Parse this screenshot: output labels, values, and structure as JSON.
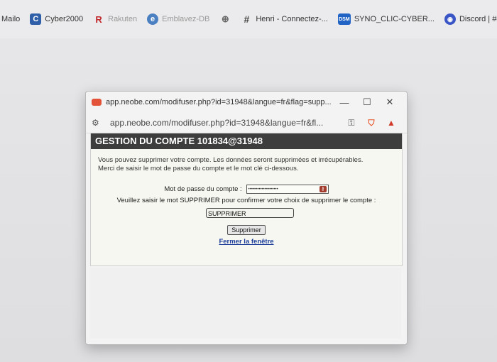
{
  "bookmarks": [
    {
      "label": "Mailo",
      "icon": "none",
      "faded": false
    },
    {
      "label": "Cyber2000",
      "icon": "cyber2000-icon",
      "glyph": "C",
      "faded": false
    },
    {
      "label": "Rakuten",
      "icon": "rakuten-icon",
      "glyph": "R",
      "faded": true
    },
    {
      "label": "Emblavez-DB",
      "icon": "emblavez-icon",
      "glyph": "e",
      "faded": true
    },
    {
      "label": "",
      "icon": "globe-icon",
      "glyph": "⊕",
      "faded": false
    },
    {
      "label": "Henri - Connectez-...",
      "icon": "hashtag-icon",
      "glyph": "#",
      "faded": false
    },
    {
      "label": "SYNO_CLIC-CYBER...",
      "icon": "syno-icon",
      "glyph": "DSM",
      "faded": false
    },
    {
      "label": "Discord | #général |...",
      "icon": "discord-icon",
      "glyph": "◉",
      "faded": false
    }
  ],
  "popup": {
    "title": "app.neobe.com/modifuser.php?id=31948&langue=fr&flag=supp...",
    "address": "app.neobe.com/modifuser.php?id=31948&langue=fr&fl...",
    "min_glyph": "—",
    "max_glyph": "☐",
    "close_glyph": "✕"
  },
  "page": {
    "header": "GESTION DU COMPTE 101834@31948",
    "intro_line1": "Vous pouvez supprimer votre compte. Les données seront supprimées et irrécupérables.",
    "intro_line2": "Merci de saisir le mot de passe du compte et le mot clé ci-dessous.",
    "password_label": "Mot de passe du compte :",
    "password_value": "••••••••••••••••••••",
    "confirm_label": "Veuillez saisir le mot SUPPRIMER pour confirmer votre choix de supprimer le compte :",
    "confirm_value": "SUPPRIMER",
    "submit_label": "Supprimer",
    "close_link": "Fermer la fenêtre"
  },
  "colors": {
    "header_bg": "#3d3d3d",
    "link": "#1d3f9a",
    "brave": "#e8542a"
  }
}
